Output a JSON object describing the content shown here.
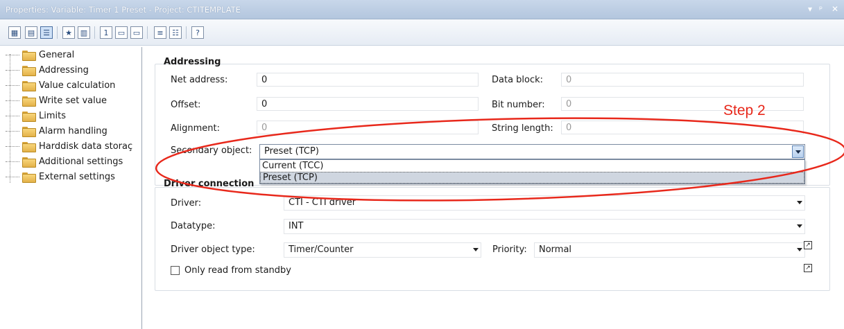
{
  "window": {
    "title": "Properties: Variable: Timer 1 Preset - Project: CTITEMPLATE",
    "controls": [
      "▾",
      "ᵖ",
      "✕"
    ]
  },
  "toolbar": {
    "icons": [
      "grid-icon",
      "page-icon",
      "view-icon",
      "favorite-icon",
      "list-icon",
      "number-icon",
      "field-icon",
      "field2-icon",
      "sort-icon",
      "list2-icon",
      "help-icon"
    ]
  },
  "tree": {
    "items": [
      {
        "label": "General"
      },
      {
        "label": "Addressing"
      },
      {
        "label": "Value calculation"
      },
      {
        "label": "Write set value"
      },
      {
        "label": "Limits"
      },
      {
        "label": "Alarm handling"
      },
      {
        "label": "Harddisk data storaç"
      },
      {
        "label": "Additional settings"
      },
      {
        "label": "External settings"
      }
    ]
  },
  "addressing": {
    "title": "Addressing",
    "net_address_label": "Net address:",
    "net_address_value": "0",
    "data_block_label": "Data block:",
    "data_block_value": "0",
    "offset_label": "Offset:",
    "offset_value": "0",
    "bit_number_label": "Bit number:",
    "bit_number_value": "0",
    "alignment_label": "Alignment:",
    "alignment_value": "0",
    "string_length_label": "String length:",
    "string_length_value": "0",
    "secondary_object_label": "Secondary object:",
    "secondary_object_value": "Preset (TCP)",
    "secondary_object_options": [
      "Current (TCC)",
      "Preset (TCP)"
    ]
  },
  "driver_connection": {
    "title": "Driver connection",
    "driver_label": "Driver:",
    "driver_value": "CTI - CTI driver",
    "datatype_label": "Datatype:",
    "datatype_value": "INT",
    "driver_object_type_label": "Driver object type:",
    "driver_object_type_value": "Timer/Counter",
    "priority_label": "Priority:",
    "priority_value": "Normal",
    "only_read_label": "Only read from standby",
    "only_read_checked": false
  },
  "annotation": {
    "step_label": "Step 2",
    "color": "#e8281b"
  }
}
